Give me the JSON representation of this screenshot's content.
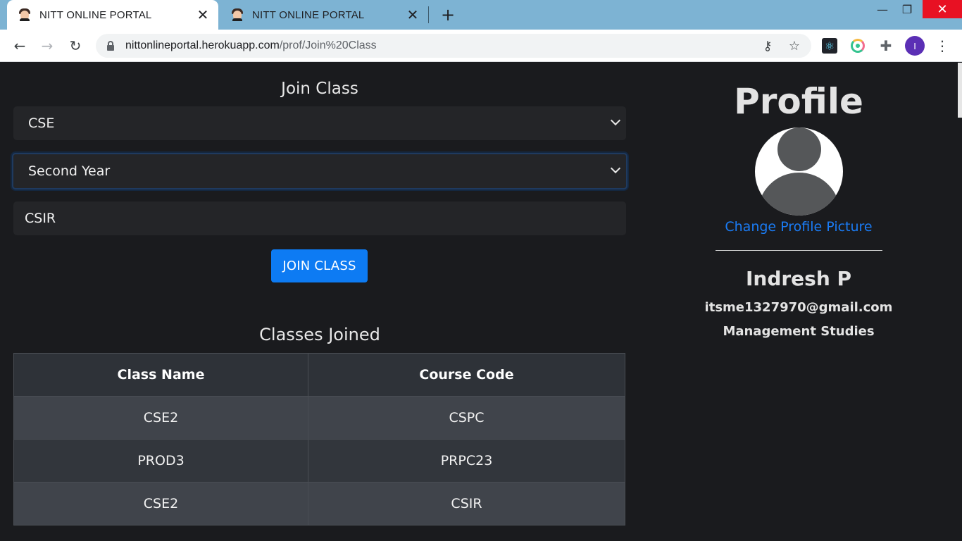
{
  "browser": {
    "tabs": [
      {
        "title": "NITT ONLINE PORTAL",
        "active": true
      },
      {
        "title": "NITT ONLINE PORTAL",
        "active": false
      }
    ],
    "url_host": "nittonlineportal.herokuapp.com",
    "url_path": "/prof/Join%20Class",
    "profile_initial": "I"
  },
  "join": {
    "heading": "Join Class",
    "department_value": "CSE",
    "year_value": "Second Year",
    "course_code_value": "CSIR",
    "button_label": "JOIN CLASS"
  },
  "classes": {
    "heading": "Classes Joined",
    "columns": [
      "Class Name",
      "Course Code"
    ],
    "rows": [
      {
        "class_name": "CSE2",
        "course_code": "CSPC"
      },
      {
        "class_name": "PROD3",
        "course_code": "PRPC23"
      },
      {
        "class_name": "CSE2",
        "course_code": "CSIR"
      }
    ]
  },
  "profile": {
    "heading": "Profile",
    "change_picture_label": "Change Profile Picture",
    "name": "Indresh P",
    "email": "itsme1327970@gmail.com",
    "department": "Management Studies"
  },
  "colors": {
    "page_bg": "#1a1b1e",
    "accent": "#0d7bf3",
    "link": "#1a7cf5",
    "tabbar": "#7db3d3",
    "close_red": "#e81123"
  }
}
